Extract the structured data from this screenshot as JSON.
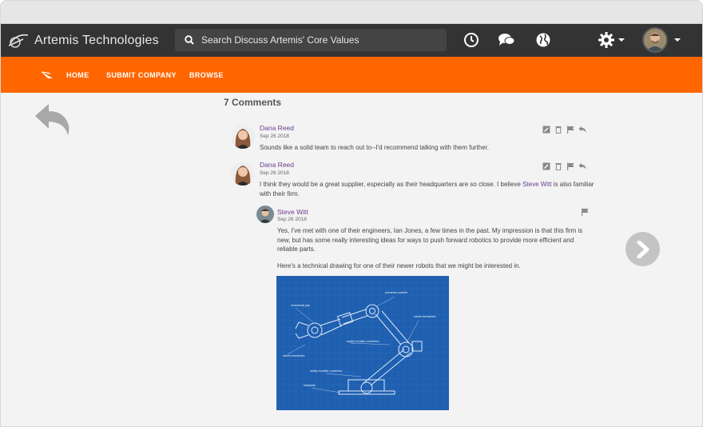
{
  "header": {
    "brand": "Artemis Technologies",
    "search_placeholder": "Search Discuss Artemis' Core Values"
  },
  "nav": {
    "items": [
      "HOME",
      "SUBMIT COMPANY",
      "BROWSE"
    ]
  },
  "comments_heading": "7 Comments",
  "comments": [
    {
      "author": "Dana Reed",
      "date": "Sep 26 2018",
      "body": "Sounds like a solid team to reach out to--I'd recommend talking with them further."
    },
    {
      "author": "Dana Reed",
      "date": "Sep 26 2018",
      "body_before": "I think they would be a great supplier, especially as their headquarters are so close. I believe ",
      "mention": "Steve Witt",
      "body_after": " is also familiar with their firm."
    },
    {
      "author": "Steve Witt",
      "date": "Sep 26 2018",
      "body_p1": "Yes, I've met with one of their engineers, Ian Jones, a few times in the past. My impression is that this firm is new, but has some really interesting ideas for ways to push forward robotics to provide more efficient and reliable parts.",
      "body_p2": "Here's a technical drawing for one of their newer robots that we might be interested in."
    }
  ],
  "blueprint_labels": {
    "pneumatic": "pneumatic cylinder",
    "grip": "mechanical grip",
    "swivel_top": "swivel mechanism",
    "swivel_left": "swivel mechanism",
    "axially1": "axially movable connection",
    "axially2": "axially movable connection",
    "baseplate": "baseplate"
  },
  "colors": {
    "topbar": "#333333",
    "navbar": "#ff6600",
    "link": "#6b3d8e",
    "blueprint": "#1f5fb0"
  }
}
